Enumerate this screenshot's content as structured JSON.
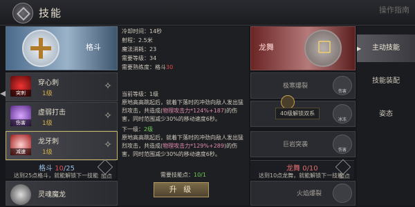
{
  "header": {
    "title": "技能",
    "top_right": "操作指南"
  },
  "left": {
    "class_label": "格斗",
    "skills": [
      {
        "name": "穿心刺",
        "level": "1级",
        "tag": "突刺"
      },
      {
        "name": "虚弱打击",
        "level": "1级",
        "tag": "伤害"
      },
      {
        "name": "龙牙刺",
        "level": "1级",
        "tag": "减速"
      },
      {
        "name": "灵魂魔龙",
        "level": "",
        "tag": ""
      }
    ],
    "bar_title_prefix": "格斗 ",
    "bar_title_num": "10",
    "bar_title_suffix": "/25",
    "bar_sub": "达到25点格斗，就能解锁下一技能",
    "bar_add": "加点"
  },
  "detail": {
    "cooldown": "冷却时间：14秒",
    "range": "射程：2.5米",
    "mana": "魔法消耗：23",
    "req_level": "需要等级：34",
    "prof_label": "需要熟练度：格斗",
    "prof_val": "30",
    "cur_label": "当前等级：",
    "cur_val": "1级",
    "cur_desc1": "原地高高跳起后，就着下落时的冲劲向敌人发出猛",
    "cur_desc2a": "烈攻击，共造成(",
    "cur_desc2b": "物理攻击力*124%+187",
    "cur_desc2c": ")的伤",
    "cur_desc3": "害，同时范围减少30%的移动速度6秒。",
    "next_label": "下一级：",
    "next_val": "2级",
    "next_desc1": "原地高高跳起后，就着下落时的冲劲向敌人发出猛",
    "next_desc2a": "烈攻击，共造成(",
    "next_desc2b": "物理攻击力*129%+289",
    "next_desc2c": ")的伤",
    "next_desc3": "害，同时范围减少30%的移动速度6秒。",
    "need_pts_label": "需要技能点：",
    "need_pts_val": "10/1",
    "upgrade": "升 级"
  },
  "right": {
    "class_label": "龙舞",
    "skills": [
      {
        "name": "极寒爆裂",
        "tag": "伤害"
      },
      {
        "name": "",
        "tag": "冰冻"
      },
      {
        "name": "巨岩突袭",
        "tag": "伤害"
      },
      {
        "name": "火焰爆裂",
        "tag": ""
      }
    ],
    "lock_text": "40级解锁双系",
    "bar_title_prefix": "龙舞 ",
    "bar_title_num": "0",
    "bar_title_suffix": "/10",
    "bar_sub": "达到10点龙舞，就能解锁下一技能",
    "bar_add": "加点"
  },
  "tabs": [
    {
      "label": "主动技能",
      "active": true
    },
    {
      "label": "技能装配",
      "active": false
    },
    {
      "label": "姿态",
      "active": false
    }
  ],
  "colors": {
    "level_gold": "#d7b24a",
    "highlight_red": "#e04a4a",
    "highlight_pink": "#e08aa8",
    "next_green": "#6fcf5a"
  }
}
